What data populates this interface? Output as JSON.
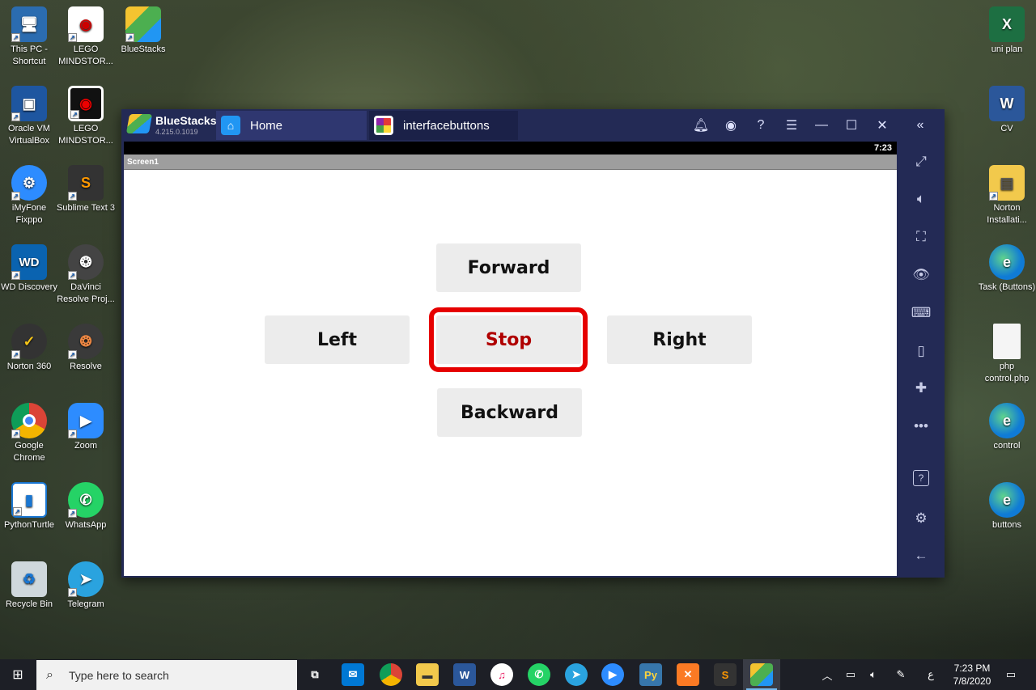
{
  "desktop": {
    "left_icons": [
      {
        "label": "This PC - Shortcut",
        "icon": "computer-icon",
        "color": "#2b6cb0"
      },
      {
        "label": "LEGO MINDSTOR...",
        "icon": "lego-mindstorms-icon",
        "color": "#ffffff"
      },
      {
        "label": "BlueStacks",
        "icon": "bluestacks-icon",
        "color": "#4caf50"
      },
      {
        "label": "Oracle VM VirtualBox",
        "icon": "virtualbox-icon",
        "color": "#1e56a0"
      },
      {
        "label": "LEGO MINDSTOR...",
        "icon": "lego-mindstorms-icon",
        "color": "#ffffff"
      },
      {
        "label": "iMyFone Fixppo",
        "icon": "imyfone-icon",
        "color": "#2d8cff"
      },
      {
        "label": "Sublime Text 3",
        "icon": "sublime-icon",
        "color": "#ff9800"
      },
      {
        "label": "WD Discovery",
        "icon": "wd-icon",
        "color": "#0a63b0"
      },
      {
        "label": "DaVinci Resolve Proj...",
        "icon": "davinci-project-icon",
        "color": "#333333"
      },
      {
        "label": "Norton 360",
        "icon": "norton-icon",
        "color": "#f5c518"
      },
      {
        "label": "Resolve",
        "icon": "davinci-resolve-icon",
        "color": "#3a3a3a"
      },
      {
        "label": "Google Chrome",
        "icon": "chrome-icon",
        "color": "#db4437"
      },
      {
        "label": "Zoom",
        "icon": "zoom-icon",
        "color": "#2d8cff"
      },
      {
        "label": "PythonTurtle",
        "icon": "python-turtle-icon",
        "color": "#1976d2"
      },
      {
        "label": "WhatsApp",
        "icon": "whatsapp-icon",
        "color": "#25d366"
      },
      {
        "label": "Recycle Bin",
        "icon": "recycle-bin-icon",
        "color": "#cfd8dc"
      },
      {
        "label": "Telegram",
        "icon": "telegram-icon",
        "color": "#2aa3df"
      }
    ],
    "right_icons": [
      {
        "label": "uni plan",
        "icon": "excel-icon",
        "color": "#1d6f42"
      },
      {
        "label": "CV",
        "icon": "word-icon",
        "color": "#2b579a"
      },
      {
        "label": "Norton Installati...",
        "icon": "folder-icon",
        "color": "#f2c94c"
      },
      {
        "label": "Task (Buttons)",
        "icon": "edge-icon",
        "color": "#0f7bd6"
      },
      {
        "label": "php control.php",
        "icon": "file-icon",
        "color": "#f5f5f5"
      },
      {
        "label": "control",
        "icon": "edge-icon",
        "color": "#0f7bd6"
      },
      {
        "label": "buttons",
        "icon": "edge-icon",
        "color": "#0f7bd6"
      }
    ]
  },
  "bluestacks": {
    "app_name": "BlueStacks",
    "version": "4.215.0.1019",
    "tabs": [
      {
        "label": "Home"
      },
      {
        "label": "interfacebuttons"
      }
    ],
    "status_time": "7:23",
    "screen_title": "Screen1",
    "buttons": {
      "forward": "Forward",
      "left": "Left",
      "stop": "Stop",
      "right": "Right",
      "backward": "Backward"
    },
    "stop_color": "#b00000",
    "highlight_color": "#e60000"
  },
  "taskbar": {
    "search_placeholder": "Type here to search",
    "time": "7:23 PM",
    "date": "7/8/2020",
    "ime": "ع"
  }
}
